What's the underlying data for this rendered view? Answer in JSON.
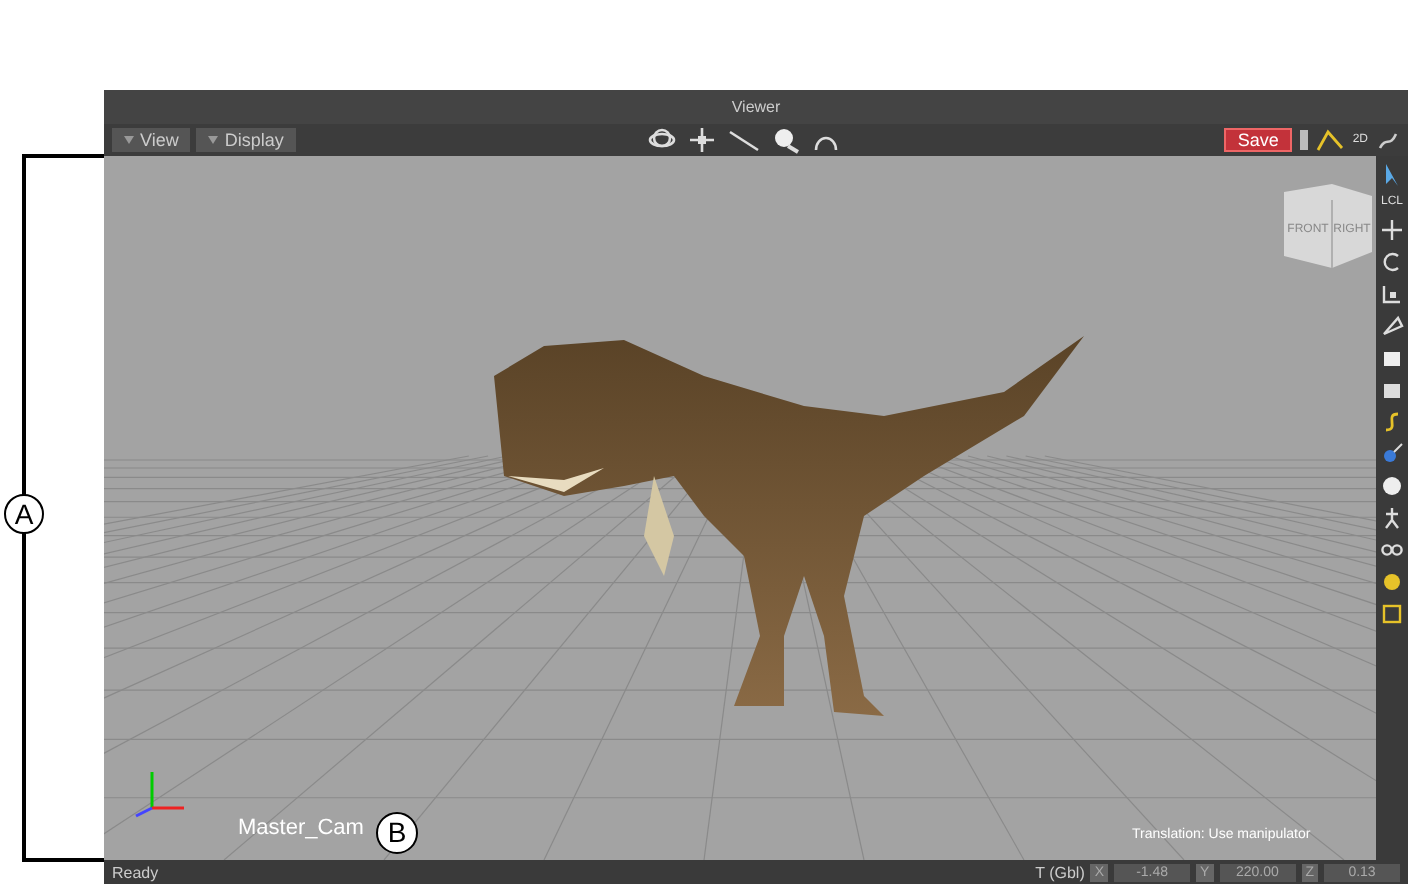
{
  "annotations": [
    {
      "label": "A"
    },
    {
      "label": "B"
    }
  ],
  "window": {
    "title": "Viewer"
  },
  "toolbar": {
    "menus": [
      {
        "label": "View"
      },
      {
        "label": "Display"
      }
    ],
    "save_button": "Save",
    "mode_label": "2D"
  },
  "side_toolbar": {
    "space_label": "LCL"
  },
  "viewport": {
    "view_cube": {
      "front": "FRONT",
      "right": "RIGHT"
    },
    "camera_name": "Master_Cam",
    "hint": "Translation: Use manipulator"
  },
  "status_bar": {
    "status": "Ready",
    "transform_label": "T (Gbl)",
    "fields": [
      {
        "axis": "X",
        "value": "-1.48"
      },
      {
        "axis": "Y",
        "value": "220.00"
      },
      {
        "axis": "Z",
        "value": "0.13"
      }
    ]
  }
}
